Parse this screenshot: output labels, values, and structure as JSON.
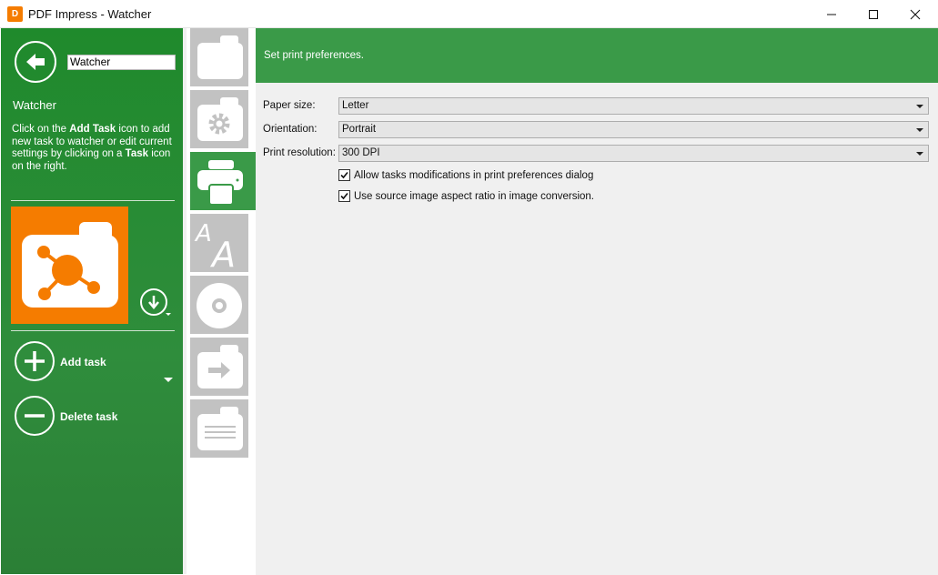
{
  "window": {
    "title": "PDF Impress - Watcher",
    "app_icon_text": "D"
  },
  "left": {
    "watcher_name_value": "Watcher",
    "heading": "Watcher",
    "desc_part1": "Click on the ",
    "desc_bold1": "Add Task",
    "desc_part2": " icon to add new task to watcher or edit current settings by clicking on a ",
    "desc_bold2": "Task",
    "desc_part3": " icon on the right.",
    "add_task_label": "Add task",
    "delete_task_label": "Delete task"
  },
  "strip": {
    "items": [
      "folder-icon",
      "settings-icon",
      "print-icon",
      "font-icon",
      "disc-icon",
      "export-icon",
      "document-icon"
    ],
    "active_index": 2
  },
  "header": {
    "text": "Set print preferences."
  },
  "form": {
    "paper_size_label": "Paper size:",
    "paper_size_value": "Letter",
    "orientation_label": "Orientation:",
    "orientation_value": "Portrait",
    "print_resolution_label": "Print resolution:",
    "print_resolution_value": "300 DPI",
    "allow_mods_label": "Allow tasks modifications in print preferences dialog",
    "allow_mods_checked": true,
    "aspect_ratio_label": "Use source image aspect ratio in image conversion.",
    "aspect_ratio_checked": true
  },
  "colors": {
    "green_dark": "#2b8a37",
    "green_header": "#3a9a48",
    "orange": "#f57c00",
    "gray_tile": "#c2c2c2"
  }
}
